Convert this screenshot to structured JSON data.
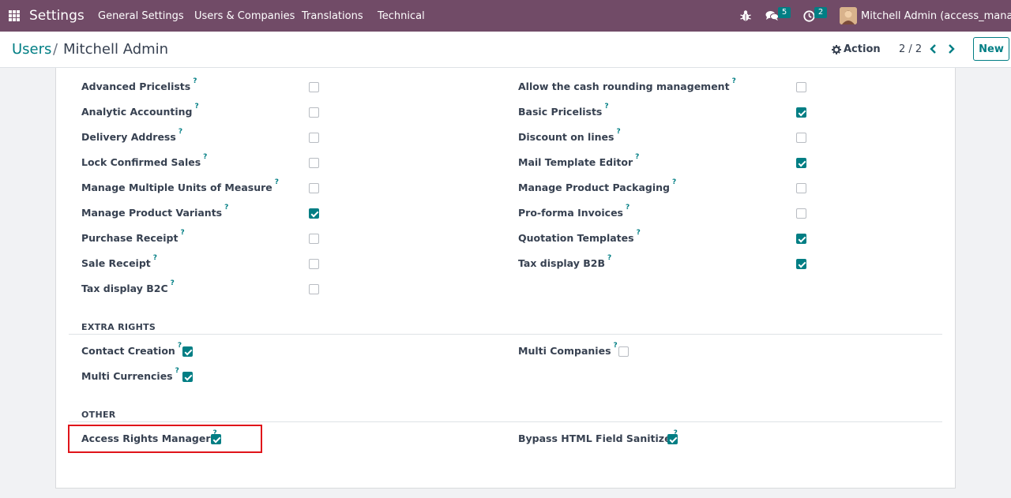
{
  "navbar": {
    "brand": "Settings",
    "menu": [
      "General Settings",
      "Users & Companies",
      "Translations",
      "Technical"
    ],
    "messages_count": "5",
    "activities_count": "2",
    "user_name": "Mitchell Admin (access_manager)"
  },
  "breadcrumb": {
    "parent": "Users",
    "separator": "/",
    "current": "Mitchell Admin"
  },
  "control": {
    "action_label": "Action",
    "pager": "2 / 2",
    "new_label": "New"
  },
  "rights_left": [
    {
      "label": "Advanced Pricelists",
      "checked": false
    },
    {
      "label": "Analytic Accounting",
      "checked": false
    },
    {
      "label": "Delivery Address",
      "checked": false
    },
    {
      "label": "Lock Confirmed Sales",
      "checked": false
    },
    {
      "label": "Manage Multiple Units of Measure",
      "checked": false
    },
    {
      "label": "Manage Product Variants",
      "checked": true
    },
    {
      "label": "Purchase Receipt",
      "checked": false
    },
    {
      "label": "Sale Receipt",
      "checked": false
    },
    {
      "label": "Tax display B2C",
      "checked": false
    }
  ],
  "rights_right": [
    {
      "label": "Allow the cash rounding management",
      "checked": false
    },
    {
      "label": "Basic Pricelists",
      "checked": true
    },
    {
      "label": "Discount on lines",
      "checked": false
    },
    {
      "label": "Mail Template Editor",
      "checked": true
    },
    {
      "label": "Manage Product Packaging",
      "checked": false
    },
    {
      "label": "Pro-forma Invoices",
      "checked": false
    },
    {
      "label": "Quotation Templates",
      "checked": true
    },
    {
      "label": "Tax display B2B",
      "checked": true
    }
  ],
  "extra_rights": {
    "title": "EXTRA RIGHTS",
    "contact_creation": {
      "label": "Contact Creation",
      "checked": true
    },
    "multi_currencies": {
      "label": "Multi Currencies",
      "checked": true
    },
    "multi_companies": {
      "label": "Multi Companies",
      "checked": false
    }
  },
  "other": {
    "title": "OTHER",
    "access_rights_manager": {
      "label": "Access Rights Manager",
      "checked": true
    },
    "bypass_html": {
      "label": "Bypass HTML Field Sanitize",
      "checked": true
    }
  },
  "help_marker": "?",
  "colors": {
    "navbar": "#714b67",
    "accent": "#017e84",
    "highlight": "#e0141a"
  }
}
